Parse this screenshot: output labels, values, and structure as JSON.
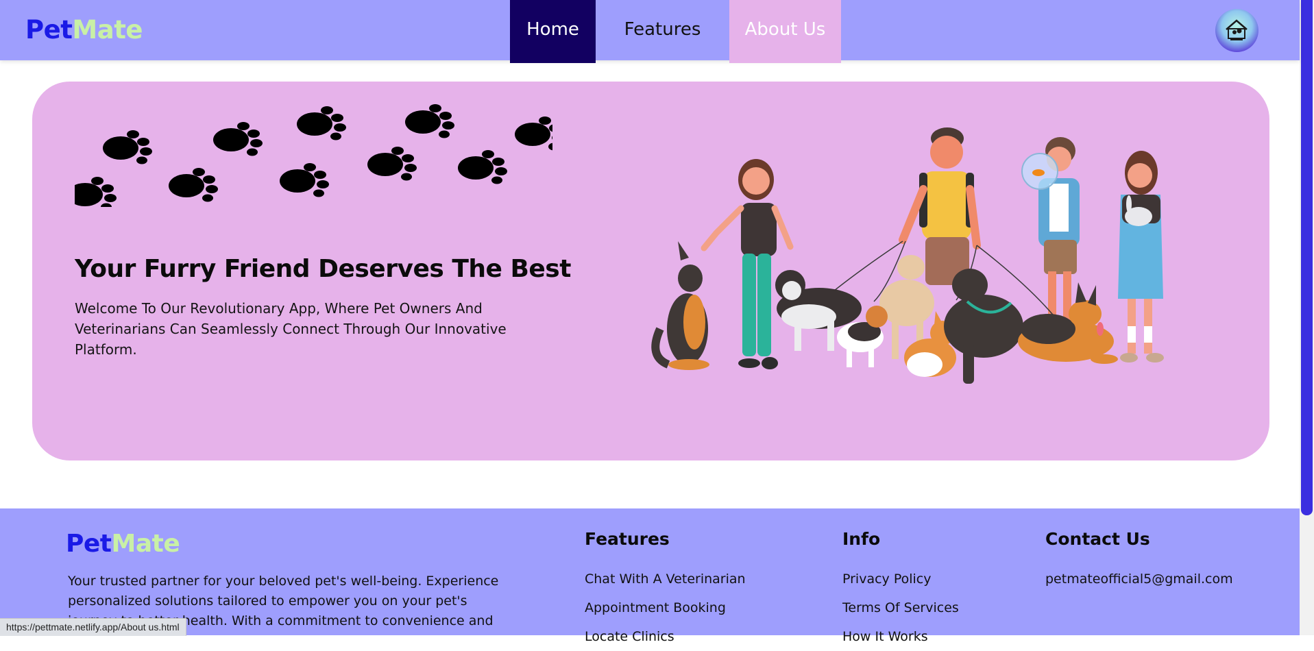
{
  "header": {
    "logo_part1": "Pet",
    "logo_part2": "Mate",
    "nav": [
      {
        "label": "Home",
        "active": true
      },
      {
        "label": "Features",
        "active": false
      },
      {
        "label": "About Us",
        "active": false
      }
    ],
    "avatar_icon": "petmate-house-logo-icon"
  },
  "hero": {
    "title": "Your Furry Friend Deserves The Best",
    "text": "Welcome To Our Revolutionary App, Where Pet Owners And Veterinarians Can Seamlessly Connect Through Our Innovative Platform.",
    "decoration_icon": "paw-prints-icon",
    "illustration": "people-with-pets-illustration"
  },
  "footer": {
    "logo_part1": "Pet",
    "logo_part2": "Mate",
    "description": "Your trusted partner for your beloved pet's well-being. Experience personalized solutions tailored to empower you on your pet's journey to better health. With a commitment to convenience and",
    "columns": [
      {
        "title": "Features",
        "items": [
          "Chat With A Veterinarian",
          "Appointment Booking",
          "Locate Clinics"
        ]
      },
      {
        "title": "Info",
        "items": [
          "Privacy Policy",
          "Terms Of Services",
          "How It Works"
        ]
      },
      {
        "title": "Contact Us",
        "items": [
          "petmateofficial5@gmail.com"
        ]
      }
    ]
  },
  "status_bar": {
    "url": "https://pettmate.netlify.app/About us.html"
  },
  "colors": {
    "header_bg": "#9e9efd",
    "hero_bg": "#e6b2ea",
    "nav_active_bg": "#120061",
    "logo_blue": "#1a1ae6",
    "logo_green": "#c9f0a6",
    "scrollbar_thumb": "#3b2fe0"
  }
}
